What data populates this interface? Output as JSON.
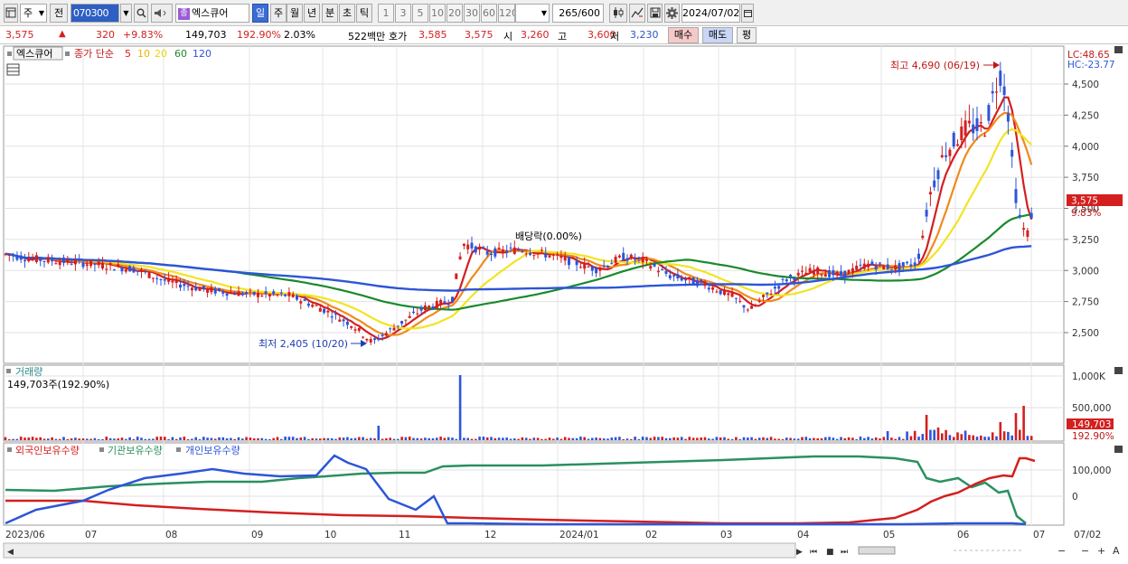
{
  "toolbar": {
    "market_label": "주",
    "prev_label": "전",
    "stock_code": "070300",
    "stock_name": "엑스큐어",
    "stock_chip": "종",
    "periods": [
      "일",
      "주",
      "월",
      "년",
      "분",
      "초",
      "틱"
    ],
    "active_period": "일",
    "intervals": [
      "1",
      "3",
      "5",
      "10",
      "20",
      "30",
      "60",
      "120"
    ],
    "count": "265",
    "count_total": "/600",
    "date": "2024/07/02"
  },
  "info": {
    "price": "3,575",
    "change": "320",
    "change_pct": "+9.83%",
    "volume": "149,703",
    "volume_ratio": "192.90%",
    "turnover_pct": "2.03%",
    "trade_value": "522백만",
    "ask_label": "호가",
    "ask": "3,585",
    "bid": "3,575",
    "open_label": "시",
    "open": "3,260",
    "high_label": "고",
    "high": "3,600",
    "low_label": "저",
    "low": "3,230",
    "buy_btn": "매수",
    "sell_btn": "매도",
    "eval_btn": "평"
  },
  "legend": {
    "name": "엑스큐어",
    "ma_title": "종가 단순",
    "ma_periods": [
      "5",
      "10",
      "20",
      "60",
      "120"
    ],
    "ma_colors": [
      "#d41f1f",
      "#f0b400",
      "#e8d800",
      "#1a8a2a",
      "#2d55d8"
    ]
  },
  "annotations": {
    "high": "최고 4,690 (06/19)",
    "low": "최저 2,405 (10/20)",
    "dividend": "배당락(0.00%)"
  },
  "right_labels": {
    "lc": "LC:48.65",
    "hc": "HC:-23.77",
    "price_tag": "3,575",
    "pct_tag": "9.83%",
    "vol_tag": "149,703",
    "vol_pct_tag": "192.90%"
  },
  "volume_pane": {
    "title": "거래량",
    "value": "149,703주(192.90%)"
  },
  "holdings_pane": {
    "series_labels": [
      "외국인보유수량",
      "기관보유수량",
      "개인보유수량"
    ]
  },
  "x_ticks": [
    "2023/06",
    "07",
    "08",
    "09",
    "10",
    "11",
    "12",
    "2024/01",
    "02",
    "03",
    "04",
    "05",
    "06",
    "07",
    "07/02"
  ],
  "price_ticks": [
    "4,500",
    "4,250",
    "4,000",
    "3,750",
    "3,500",
    "3,250",
    "3,000",
    "2,750",
    "2,500"
  ],
  "volume_ticks": [
    "1,000K",
    "500,000"
  ],
  "holdings_ticks": [
    "100,000",
    "0"
  ],
  "colors": {
    "up": "#d41f1f",
    "down": "#2d55d8",
    "ma5": "#d41f1f",
    "ma10": "#f08a1c",
    "ma20": "#f2e422",
    "ma60": "#1a8a2a",
    "ma120": "#2d55d8",
    "foreign": "#d41f1f",
    "institution": "#2a9060",
    "individual": "#2d55d8"
  },
  "chart_data": {
    "type": "line",
    "price_range": [
      2400,
      4690
    ],
    "high": {
      "value": 4690,
      "date": "06/19"
    },
    "low": {
      "value": 2405,
      "date": "10/20"
    },
    "close_series_approx": [
      [
        "2023/06",
        3120
      ],
      [
        "07",
        3060
      ],
      [
        "08",
        2900
      ],
      [
        "09",
        2820
      ],
      [
        "10",
        2640
      ],
      [
        "10/20",
        2420
      ],
      [
        "11",
        2780
      ],
      [
        "12",
        3100
      ],
      [
        "2024/01",
        3050
      ],
      [
        "02",
        3020
      ],
      [
        "03",
        2700
      ],
      [
        "04",
        2980
      ],
      [
        "05",
        3060
      ],
      [
        "06/19",
        4600
      ],
      [
        "07/02",
        3575
      ]
    ]
  }
}
